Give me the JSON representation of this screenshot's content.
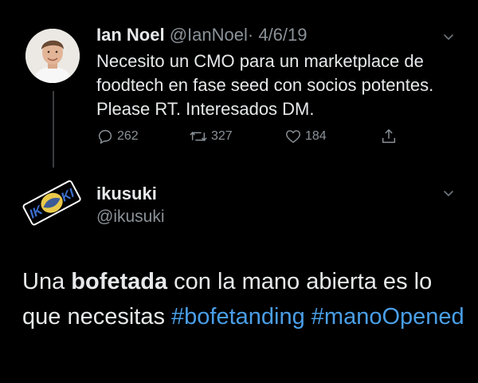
{
  "tweet1": {
    "author_name": "Ian Noel",
    "author_handle": "@IanNoel",
    "separator": "·",
    "date": "4/6/19",
    "text": "Necesito un CMO para un marketplace de foodtech en fase seed con socios potentes. Please RT. Interesados DM.",
    "actions": {
      "replies": {
        "icon": "reply-icon",
        "count": "262"
      },
      "retweets": {
        "icon": "retweet-icon",
        "count": "327"
      },
      "likes": {
        "icon": "heart-icon",
        "count": "184"
      },
      "share": {
        "icon": "share-icon"
      }
    },
    "menu_icon": "chevron-down-icon"
  },
  "tweet2": {
    "author_name": "ikusuki",
    "author_handle": "@ikusuki",
    "avatar_logo_text": "IKSUKI",
    "text_prefix": "Una ",
    "text_bold": "bofetada",
    "text_middle": " con la mano abierta es lo que necesitas ",
    "hashtag1": "#bofetanding",
    "text_space": " ",
    "hashtag2": "#manoOpened",
    "menu_icon": "chevron-down-icon"
  },
  "colors": {
    "background": "#000000",
    "text": "#e7e9ea",
    "muted": "#8b9298",
    "hashtag": "#4a9fe8"
  }
}
